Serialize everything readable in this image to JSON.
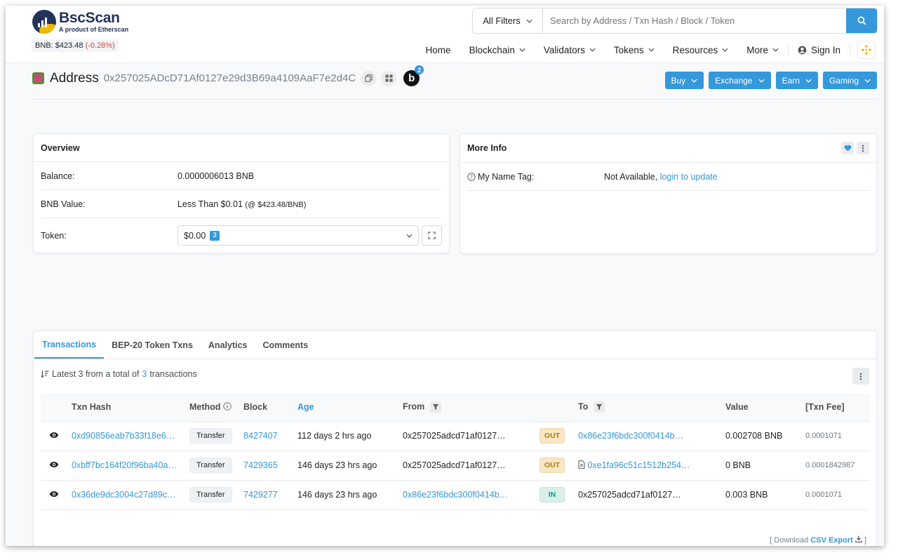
{
  "brand": {
    "name": "BscScan",
    "tagline": "A product of Etherscan"
  },
  "price": {
    "label": "BNB: $423.48",
    "change": "(-0.28%)"
  },
  "search": {
    "filter": "All Filters",
    "placeholder": "Search by Address / Txn Hash / Block / Token"
  },
  "nav": {
    "home": "Home",
    "blockchain": "Blockchain",
    "validators": "Validators",
    "tokens": "Tokens",
    "resources": "Resources",
    "more": "More",
    "signin": "Sign In"
  },
  "address": {
    "label": "Address",
    "hash": "0x257025ADcD71Af0127e29d3B69a4109AaF7e2d4C",
    "badge_letter": "b",
    "badge_count": "2"
  },
  "actions": {
    "buy": "Buy",
    "exchange": "Exchange",
    "earn": "Earn",
    "gaming": "Gaming"
  },
  "overview": {
    "title": "Overview",
    "balance_label": "Balance:",
    "balance_value": "0.0000006013 BNB",
    "value_label": "BNB Value:",
    "value_main": "Less Than $0.01",
    "value_rate": "(@ $423.48/BNB)",
    "token_label": "Token:",
    "token_value": "$0.00",
    "token_count": "3"
  },
  "more_info": {
    "title": "More Info",
    "name_tag_label": "My Name Tag:",
    "name_tag_value": "Not Available,",
    "name_tag_link": "login to update"
  },
  "tabs": [
    "Transactions",
    "BEP-20 Token Txns",
    "Analytics",
    "Comments"
  ],
  "summary": {
    "prefix": "Latest 3 from a total of",
    "count": "3",
    "suffix": "transactions"
  },
  "table": {
    "headers": {
      "hash": "Txn Hash",
      "method": "Method",
      "block": "Block",
      "age": "Age",
      "from": "From",
      "to": "To",
      "value": "Value",
      "fee": "[Txn Fee]"
    },
    "rows": [
      {
        "hash": "0xd90856eab7b33f18e6…",
        "method": "Transfer",
        "block": "8427407",
        "age": "112 days 2 hrs ago",
        "from": "0x257025adcd71af0127…",
        "dir": "OUT",
        "to": "0x86e23f6bdc300f0414b…",
        "value": "0.002708 BNB",
        "fee": "0.0001071"
      },
      {
        "hash": "0xbff7bc164f20f96ba40a…",
        "method": "Transfer",
        "block": "7429365",
        "age": "146 days 23 hrs ago",
        "from": "0x257025adcd71af0127…",
        "dir": "OUT",
        "to": "0xe1fa96c51c1512b254…",
        "value": "0 BNB",
        "fee": "0.0001842987"
      },
      {
        "hash": "0x36de9dc3004c27d89c…",
        "method": "Transfer",
        "block": "7429277",
        "age": "146 days 23 hrs ago",
        "from": "0x86e23f6bdc300f0414b…",
        "dir": "IN",
        "to": "0x257025adcd71af0127…",
        "value": "0.003 BNB",
        "fee": "0.0001071"
      }
    ]
  },
  "csv": {
    "prefix": "[ Download",
    "link": "CSV Export",
    "suffix": "]"
  },
  "colors": {
    "primary": "#3498db",
    "navy": "#21325b",
    "negative": "#de4437"
  }
}
